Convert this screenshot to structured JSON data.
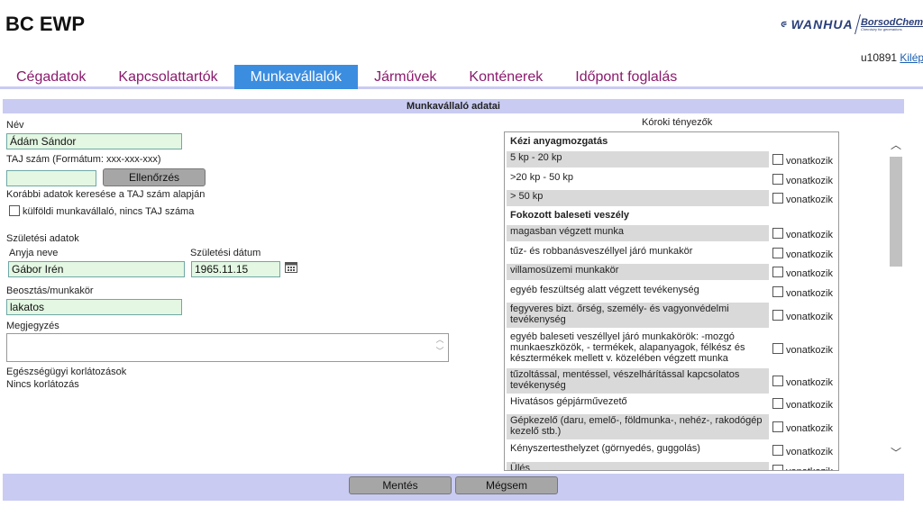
{
  "header": {
    "title": "BC EWP",
    "logo_text": "WANHUA",
    "logo_sub_main": "BorsodChem",
    "logo_sub_tag": "Chemistry for generations"
  },
  "user": {
    "id": "u10891",
    "logout_label": "Kilépés"
  },
  "tabs": [
    {
      "label": "Cégadatok",
      "active": false
    },
    {
      "label": "Kapcsolattartók",
      "active": false
    },
    {
      "label": "Munkavállalók",
      "active": true
    },
    {
      "label": "Járművek",
      "active": false
    },
    {
      "label": "Konténerek",
      "active": false
    },
    {
      "label": "Időpont foglalás",
      "active": false
    }
  ],
  "form": {
    "section_title": "Munkavállaló adatai",
    "name_label": "Név",
    "name_value": "Ádám Sándor",
    "taj_label": "TAJ szám (Formátum: xxx-xxx-xxx)",
    "taj_value": "",
    "check_button": "Ellenőrzés",
    "taj_search_label": "Korábbi adatok keresése a TAJ szám alapján",
    "foreign_worker_label": "külföldi munkavállaló, nincs TAJ száma",
    "birth_data_label": "Születési adatok",
    "mother_name_label": "Anyja neve",
    "mother_name_value": "Gábor Irén",
    "birth_date_label": "Születési dátum",
    "birth_date_value": "1965.11.15",
    "position_label": "Beosztás/munkakör",
    "position_value": "lakatos",
    "note_label": "Megjegyzés",
    "note_value": "",
    "health_label": "Egészségügyi korlátozások",
    "health_value": "Nincs korlátozás"
  },
  "risk": {
    "title": "Kóroki tényezők",
    "checkbox_label": "vonatkozik",
    "rows": [
      {
        "type": "category",
        "label": "Kézi anyagmozgatás"
      },
      {
        "type": "item",
        "label": "5 kp - 20 kp"
      },
      {
        "type": "item",
        "label": ">20 kp - 50 kp"
      },
      {
        "type": "item",
        "label": "> 50 kp"
      },
      {
        "type": "category",
        "label": "Fokozott baleseti veszély"
      },
      {
        "type": "item",
        "label": "magasban végzett munka"
      },
      {
        "type": "item",
        "label": "tűz- és robbanásveszéllyel járó munkakör"
      },
      {
        "type": "item",
        "label": "villamosüzemi munkakör"
      },
      {
        "type": "item",
        "label": "egyéb feszültség alatt végzett tevékenység"
      },
      {
        "type": "item",
        "label": "fegyveres bizt. őrség, személy- és vagyonvédelmi tevékenység"
      },
      {
        "type": "item",
        "label": "egyéb baleseti veszéllyel járó munkakörök: -mozgó munkaeszközök, - termékek, alapanyagok, félkész és késztermékek mellett v. közelében végzett munka"
      },
      {
        "type": "item",
        "label": "tűzoltással, mentéssel, vészelhárítással kapcsolatos tevékenység"
      },
      {
        "type": "item",
        "label": "Hivatásos gépjárművezető"
      },
      {
        "type": "item",
        "label": "Gépkezelő (daru, emelő-, földmunka-, nehéz-, rakodógép kezelő stb.)"
      },
      {
        "type": "item",
        "label": "Kényszertesthelyzet (görnyedés, guggolás)"
      },
      {
        "type": "item",
        "label": "Ülés"
      }
    ]
  },
  "footer": {
    "save_label": "Mentés",
    "cancel_label": "Mégsem"
  }
}
